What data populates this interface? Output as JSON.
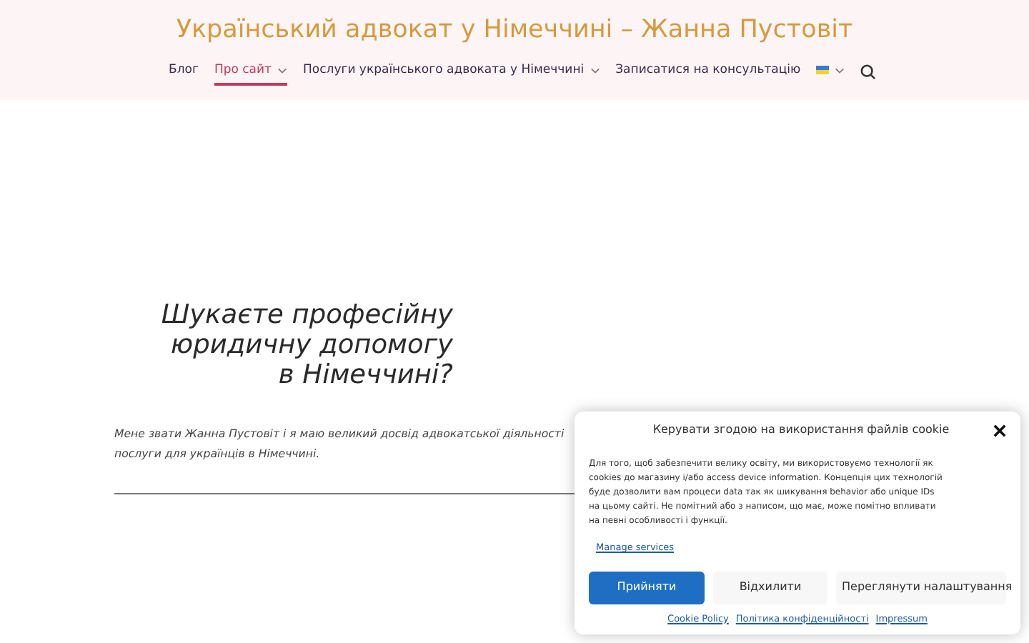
{
  "site_title": "Український адвокат у Німеччині – Жанна Пустовіт",
  "nav": [
    {
      "kind": "link",
      "label": "Блог",
      "selected": false,
      "dropdown": false
    },
    {
      "kind": "link",
      "label": "Про сайт",
      "selected": true,
      "dropdown": true
    },
    {
      "kind": "link",
      "label": "Послуги українського адвоката у Німеччині",
      "selected": false,
      "dropdown": true
    },
    {
      "kind": "link",
      "label": "Записатися на консультацію",
      "selected": false,
      "dropdown": false
    },
    {
      "kind": "flag",
      "selected": false,
      "dropdown": true
    }
  ],
  "hero": {
    "heading": [
      "Шукаєте професійну",
      "юридичну допомогу",
      "в Німеччині?"
    ],
    "paragraph": [
      "Мене звати Жанна Пустовіт і я маю великий досвід адвокатської діяльності",
      "послуги для українців в Німеччині."
    ]
  },
  "cookie_dialog": {
    "title": "Керувати згодою на використання файлів cookie",
    "body": "Для того, щоб забезпечити велику освіту, ми використовуємо технології як cookies до магазину і/або access device information. Концепція цих технологій буде дозволити вам процеси data так як шикування behavior або unique IDs на цьому сайті. Не помітний або з написом, що має, може помітно впливати на певні особливості і функції.",
    "manage_link": "Manage services",
    "buttons": [
      {
        "kind": "primary",
        "label": "Прийняти"
      },
      {
        "kind": "secondary",
        "label": "Відхилити"
      },
      {
        "kind": "secondary",
        "label": "Переглянути налаштування"
      }
    ],
    "footer_links": [
      "Cookie Policy",
      "Політика конфіденційності",
      "Impressum"
    ]
  }
}
